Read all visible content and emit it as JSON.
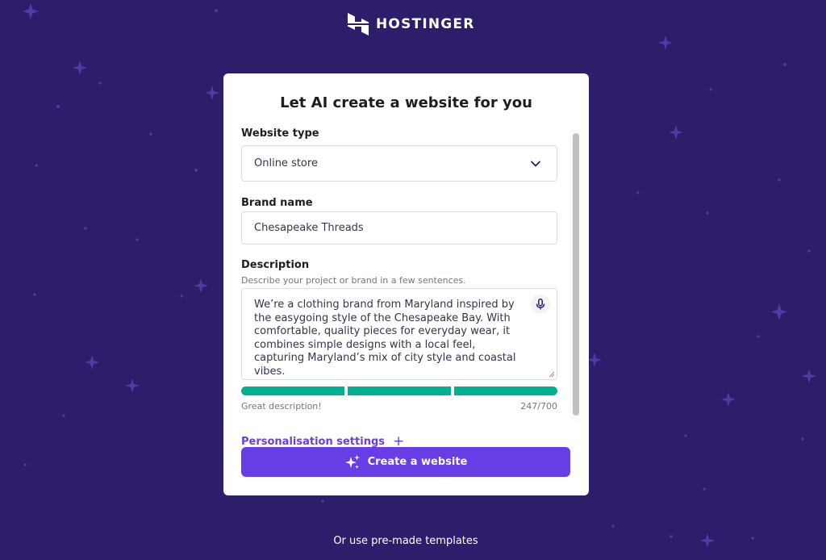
{
  "brand": {
    "name": "HOSTINGER",
    "logo_icon": "hostinger-h-logo"
  },
  "card": {
    "title": "Let AI create a website for you",
    "website_type": {
      "label": "Website type",
      "selected": "Online store",
      "icon": "chevron-down-icon"
    },
    "brand_name": {
      "label": "Brand name",
      "value": "Chesapeake Threads"
    },
    "description": {
      "label": "Description",
      "hint": "Describe your project or brand in a few sentences.",
      "value": "We’re a clothing brand from Maryland inspired by the easygoing style of the Chesapeake Bay. With comfortable, quality pieces for everyday wear, it combines simple designs with a local feel, capturing Maryland’s mix of city style and coastal vibes.",
      "mic_icon": "microphone-icon",
      "quality_segments_filled": 3,
      "quality_segments_total": 3,
      "quality_color": "#00b090",
      "feedback": "Great description!",
      "counter": "247/700"
    },
    "personalisation": {
      "label": "Personalisation settings",
      "icon": "plus-icon"
    },
    "create_button": {
      "label": "Create a website",
      "icon": "sparkles-icon"
    }
  },
  "footer": {
    "templates_link": "Or use pre-made templates"
  },
  "colors": {
    "background": "#2d1d6b",
    "accent": "#673de6",
    "success": "#00b090"
  }
}
